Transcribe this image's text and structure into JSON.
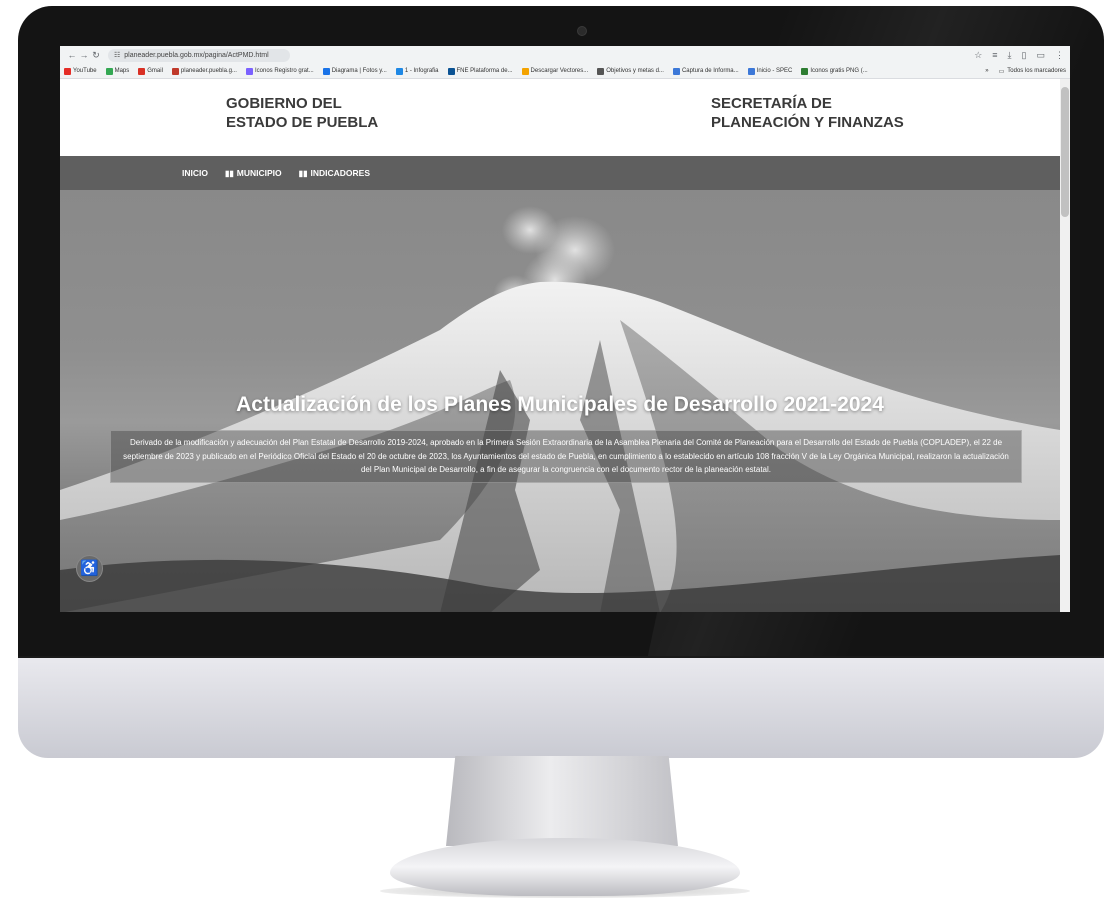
{
  "browser": {
    "url": "planeader.puebla.gob.mx/pagina/ActPMD.html",
    "bookmarks": [
      {
        "label": "YouTube",
        "color": "#e52d27"
      },
      {
        "label": "Maps",
        "color": "#34a853"
      },
      {
        "label": "Gmail",
        "color": "#d93025"
      },
      {
        "label": "planeader.puebla.g...",
        "color": "#c0392b"
      },
      {
        "label": "Iconos Registro grat...",
        "color": "#7b61ff"
      },
      {
        "label": "Diagrama | Fotos y...",
        "color": "#1a73e8"
      },
      {
        "label": "1 - Infografia",
        "color": "#1e88e5"
      },
      {
        "label": "FNE Plataforma de...",
        "color": "#0b5394"
      },
      {
        "label": "Descargar Vectores...",
        "color": "#f4a300"
      },
      {
        "label": "Objetivos y metas d...",
        "color": "#555555"
      },
      {
        "label": "Captura de Informa...",
        "color": "#3c78d8"
      },
      {
        "label": "Inicio - SPEC",
        "color": "#3c78d8"
      },
      {
        "label": "Iconos gratis PNG (...",
        "color": "#2e7d32"
      }
    ],
    "all_bookmarks_label": "Todos los marcadores"
  },
  "header": {
    "left_line1": "GOBIERNO DEL",
    "left_line2": "ESTADO DE PUEBLA",
    "right_line1": "SECRETARÍA DE",
    "right_line2": "PLANEACIÓN Y FINANZAS"
  },
  "nav": {
    "inicio": "INICIO",
    "municipio": "MUNICIPIO",
    "indicadores": "INDICADORES"
  },
  "hero": {
    "title": "Actualización de los Planes Municipales de Desarrollo 2021-2024",
    "body": "Derivado de la modificación y adecuación del Plan Estatal de Desarrollo 2019-2024, aprobado en la Primera Sesión Extraordinaria de la Asamblea Plenaria del Comité de Planeación para el Desarrollo del Estado de Puebla (COPLADEP), el 22 de septiembre de 2023 y publicado en el Periódico Oficial del Estado el 20 de octubre de 2023, los Ayuntamientos del estado de Puebla, en cumplimiento a lo establecido en artículo 108 fracción V de la Ley Orgánica Municipal, realizaron la actualización del Plan Municipal de Desarrollo, a fin de asegurar la congruencia con el documento rector de la planeación estatal."
  }
}
